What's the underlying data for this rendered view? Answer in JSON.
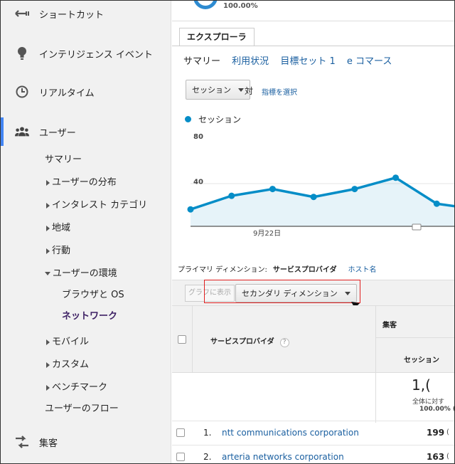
{
  "sidebar": {
    "shortcut": "ショートカット",
    "intelligence": "インテリジェンス イベント",
    "realtime": "リアルタイム",
    "users": "ユーザー",
    "sub": {
      "summary": "サマリー",
      "distribution": "ユーザーの分布",
      "interests": "インタレスト カテゴリ",
      "geo": "地域",
      "behavior": "行動",
      "environment": "ユーザーの環境",
      "browser_os": "ブラウザと OS",
      "network": "ネットワーク",
      "mobile": "モバイル",
      "custom": "カスタム",
      "benchmark": "ベンチマーク",
      "flow": "ユーザーのフロー"
    },
    "acquisition": "集客"
  },
  "main": {
    "top_pct": "100.00%",
    "explorer_tab": "エクスプローラ",
    "subtabs": [
      "サマリー",
      "利用状況",
      "目標セット 1",
      "e コマース"
    ],
    "metric_select": "セッション",
    "vs": "対",
    "choose_metric": "指標を選択",
    "legend": "セッション",
    "primary_dim_label": "プライマリ ディメンション:",
    "primary_dim_value": "サービスプロバイダ",
    "host_name": "ホスト名",
    "graph_btn": "グラフに表示",
    "secondary_dim": "セカンダリ ディメンション"
  },
  "table": {
    "col_provider": "サービスプロバイダ",
    "help": "?",
    "group_acq": "集客",
    "col_sessions": "セッション",
    "total_big": "1,(",
    "total_sub": "全体に対す",
    "total_pct": "100.00% (",
    "rows": [
      {
        "idx": "1.",
        "name": "ntt communications corporation",
        "sessions": "199",
        "extra": "("
      },
      {
        "idx": "2.",
        "name": "arteria networks corporation",
        "sessions": "163",
        "extra": "("
      }
    ]
  },
  "chart_data": {
    "type": "line",
    "series": [
      {
        "values": [
          15,
          27,
          33,
          26,
          33,
          43,
          20,
          15
        ]
      }
    ],
    "ylim": [
      0,
      100
    ],
    "yticks": [
      "80",
      "40"
    ],
    "xtick": "9月22日",
    "color": "#058dc7"
  }
}
